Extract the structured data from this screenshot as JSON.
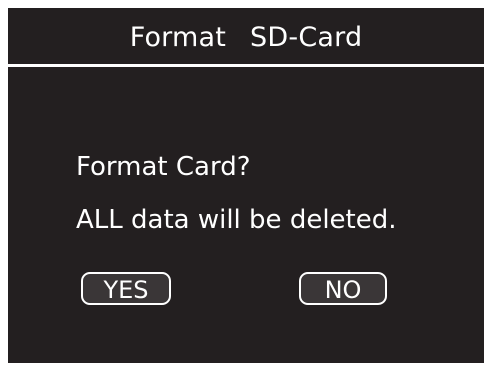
{
  "header": {
    "title_word1": "Format",
    "title_word2": "SD-Card"
  },
  "dialog": {
    "prompt": "Format Card?",
    "warning": "ALL data will be deleted.",
    "yes_label": "YES",
    "no_label": "NO"
  },
  "colors": {
    "background": "#231f20",
    "text": "#ffffff",
    "button_fill": "#3a3637"
  }
}
